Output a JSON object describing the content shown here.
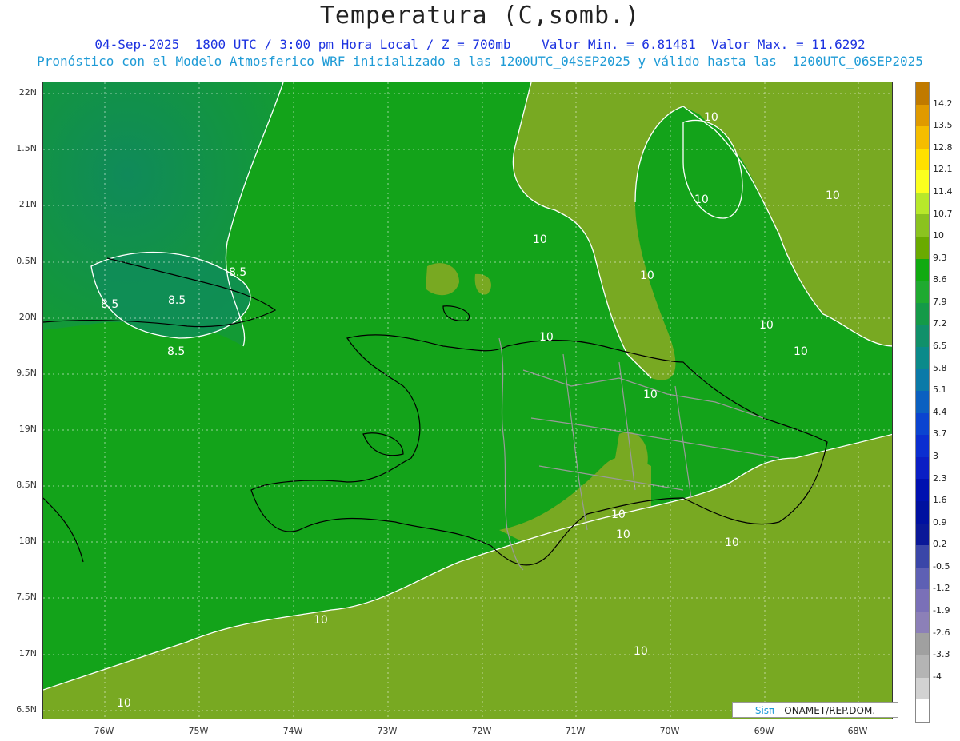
{
  "header": {
    "title": "Temperatura (C,somb.)",
    "line1": "04-Sep-2025  1800 UTC / 3:00 pm Hora Local / Z = 700mb    Valor Min. = 6.81481  Valor Max. = 11.6292",
    "line2": "Pronóstico con el Modelo Atmosferico WRF inicializado a las 1200UTC_04SEP2025 y válido hasta las  1200UTC_06SEP2025"
  },
  "axes": {
    "lat_ticks": [
      "22N",
      "1.5N",
      "21N",
      "0.5N",
      "20N",
      "9.5N",
      "19N",
      "8.5N",
      "18N",
      "7.5N",
      "17N",
      "6.5N"
    ],
    "lon_ticks": [
      "76W",
      "75W",
      "74W",
      "73W",
      "72W",
      "71W",
      "70W",
      "69W",
      "68W"
    ]
  },
  "contour_labels": [
    "8.5",
    "8.5",
    "8.5",
    "8.5",
    "10",
    "10",
    "10",
    "10",
    "10",
    "10",
    "10",
    "10",
    "10",
    "10",
    "10",
    "10",
    "10",
    "10",
    "10"
  ],
  "colorbar": {
    "labels": [
      "14.2",
      "13.5",
      "12.8",
      "12.1",
      "11.4",
      "10.7",
      "10",
      "9.3",
      "8.6",
      "7.9",
      "7.2",
      "6.5",
      "5.8",
      "5.1",
      "4.4",
      "3.7",
      "3",
      "2.3",
      "1.6",
      "0.9",
      "0.2",
      "-0.5",
      "-1.2",
      "-1.9",
      "-2.6",
      "-3.3",
      "-4"
    ],
    "colors": [
      "#c07a00",
      "#e09a00",
      "#f5bd00",
      "#ffe000",
      "#fbff1e",
      "#b8e82a",
      "#8bc31f",
      "#6aaa00",
      "#10aa10",
      "#1faa30",
      "#149a48",
      "#10906a",
      "#0a8a8a",
      "#0a7aa8",
      "#0a60c0",
      "#0a44d0",
      "#0a2ed0",
      "#0a1ec4",
      "#0010b0",
      "#0010a0",
      "#0a1898",
      "#3a46a8",
      "#5e60b4",
      "#7a70b8",
      "#8c80b8",
      "#a0a0a0",
      "#b4b4b4",
      "#d2d2d2",
      "#ffffff"
    ]
  },
  "colors": {
    "base_green": "#13a31a",
    "warm_olive": "#78a922",
    "cool_teal": "#108c58",
    "contour": "#ffffff",
    "coast": "#000000",
    "border": "#9a9a9a"
  },
  "credit": {
    "sis": "Sisπ",
    "rest": "- ONAMET/REP.DOM."
  }
}
